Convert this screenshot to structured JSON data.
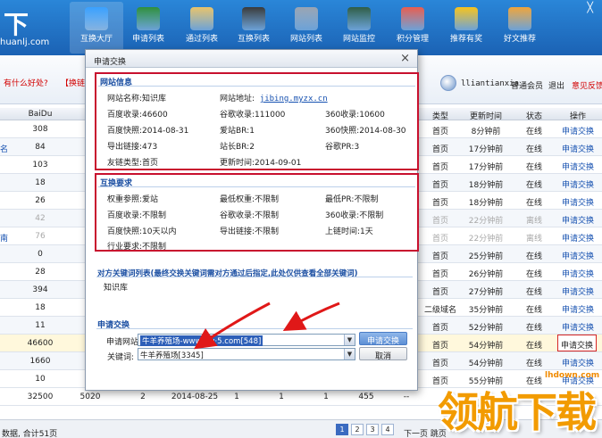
{
  "header": {
    "logo_big": "下",
    "logo_small": "huanlj.com",
    "nav": [
      {
        "label": "互换大厅",
        "icon": "monitor-icon",
        "color": "#3aa0ff"
      },
      {
        "label": "申请列表",
        "icon": "pie-chart-icon",
        "color": "#2f8f3c"
      },
      {
        "label": "通过列表",
        "icon": "clipboard-icon",
        "color": "#e8c36a"
      },
      {
        "label": "互换列表",
        "icon": "screen-icon",
        "color": "#3a3a3a"
      },
      {
        "label": "网站列表",
        "icon": "phone-icon",
        "color": "#9aa4b2"
      },
      {
        "label": "网站监控",
        "icon": "globe-icon",
        "color": "#2f5d45"
      },
      {
        "label": "积分管理",
        "icon": "calendar-icon",
        "color": "#e85d4f"
      },
      {
        "label": "推荐有奖",
        "icon": "star-icon",
        "color": "#f7c21c"
      },
      {
        "label": "好文推荐",
        "icon": "at-icon",
        "color": "#f0a43a"
      }
    ]
  },
  "infobar": {
    "tip_question": "有什么好处?",
    "tip_bracket": "【换链",
    "username": "lliantianxia",
    "level": "普通会员",
    "logout": "退出",
    "feedback": "意见反馈"
  },
  "table": {
    "headers": [
      "BaiDu",
      "类型",
      "更新时间",
      "状态",
      "操作"
    ],
    "rows": [
      {
        "baidu": "308",
        "type": "首页",
        "time": "8分钟前",
        "status": "在线",
        "action": "申请交换",
        "left": "",
        "grey": false
      },
      {
        "baidu": "84",
        "type": "首页",
        "time": "17分钟前",
        "status": "在线",
        "action": "申请交换",
        "left": "名",
        "grey": false
      },
      {
        "baidu": "103",
        "type": "首页",
        "time": "17分钟前",
        "status": "在线",
        "action": "申请交换",
        "left": "",
        "grey": false
      },
      {
        "baidu": "18",
        "type": "首页",
        "time": "18分钟前",
        "status": "在线",
        "action": "申请交换",
        "left": "",
        "grey": false
      },
      {
        "baidu": "26",
        "type": "首页",
        "time": "18分钟前",
        "status": "在线",
        "action": "申请交换",
        "left": "",
        "grey": false
      },
      {
        "baidu": "42",
        "type": "首页",
        "time": "22分钟前",
        "status": "离线",
        "action": "申请交换",
        "left": "",
        "grey": true
      },
      {
        "baidu": "76",
        "type": "首页",
        "time": "22分钟前",
        "status": "离线",
        "action": "申请交换",
        "left": "南",
        "grey": true
      },
      {
        "baidu": "0",
        "type": "首页",
        "time": "25分钟前",
        "status": "在线",
        "action": "申请交换",
        "left": "",
        "grey": false
      },
      {
        "baidu": "28",
        "type": "首页",
        "time": "26分钟前",
        "status": "在线",
        "action": "申请交换",
        "left": "",
        "grey": false
      },
      {
        "baidu": "394",
        "type": "首页",
        "time": "27分钟前",
        "status": "在线",
        "action": "申请交换",
        "left": "",
        "grey": false
      },
      {
        "baidu": "18",
        "type": "二级域名",
        "time": "35分钟前",
        "status": "在线",
        "action": "申请交换",
        "left": "",
        "grey": false
      },
      {
        "baidu": "11",
        "type": "首页",
        "time": "52分钟前",
        "status": "在线",
        "action": "申请交换",
        "left": "",
        "grey": false
      },
      {
        "baidu": "46600",
        "type": "首页",
        "time": "54分钟前",
        "status": "在线",
        "action": "申请交换",
        "left": "",
        "grey": false
      },
      {
        "baidu": "1660",
        "type": "首页",
        "time": "54分钟前",
        "status": "在线",
        "action": "申请交换",
        "left": "",
        "grey": false
      },
      {
        "baidu": "10",
        "type": "首页",
        "time": "55分钟前",
        "status": "在线",
        "action": "申请交换",
        "left": "",
        "grey": false
      }
    ],
    "last_row": [
      "32500",
      "5020",
      "2",
      "2014-08-25",
      "1",
      "1",
      "1",
      "455",
      "--"
    ],
    "footer_text": "数据, 合计51页",
    "pages": [
      "1",
      "2",
      "3",
      "4"
    ],
    "pager_tail": "下一页 跳页"
  },
  "watermark": {
    "url": "lhdown.com",
    "text": "领航下载"
  },
  "dialog": {
    "title": "申请交换",
    "site_info": {
      "title": "网站信息",
      "site_name_label": "网站名称:",
      "site_name": "知识库",
      "site_url_label": "网站地址:",
      "site_url": "jibing.myzx.cn",
      "baidu_label": "百度收录:",
      "baidu": "46600",
      "google_label": "谷歌收录:",
      "google": "111000",
      "s360_label": "360收录:",
      "s360": "10600",
      "baidu_snap_label": "百度快照:",
      "baidu_snap": "2014-08-31",
      "aizhan_br_label": "爱站BR:",
      "aizhan_br": "1",
      "snap360_label": "360快照:",
      "snap360": "2014-08-30",
      "outlinks_label": "导出链接:",
      "outlinks": "473",
      "zhanzhang_br_label": "站长BR:",
      "zhanzhang_br": "2",
      "google_pr_label": "谷歌PR:",
      "google_pr": "3",
      "link_type_label": "友链类型:",
      "link_type": "首页",
      "updated_label": "更新时间:",
      "updated": "2014-09-01"
    },
    "requirements": {
      "title": "互换要求",
      "weight_label": "权重参照:",
      "weight": "爱站",
      "min_weight_label": "最低权重:",
      "min_weight": "不限制",
      "min_pr_label": "最低PR:",
      "min_pr": "不限制",
      "baidu_label": "百度收录:",
      "baidu": "不限制",
      "google_label": "谷歌收录:",
      "google": "不限制",
      "s360_label": "360收录:",
      "s360": "不限制",
      "snap_label": "百度快照:",
      "snap": "10天以内",
      "outlinks_label": "导出链接:",
      "outlinks": "不限制",
      "online_label": "上链时间:",
      "online": "1天",
      "industry_label": "行业要求:",
      "industry": "不限制"
    },
    "keywords": {
      "title": "对方关键词列表(最终交换关键词需对方通过后指定,此处仅供查看全部关键词)",
      "value": "知识库"
    },
    "apply": {
      "title": "申请交换",
      "site_label": "申请网站:",
      "site_value": "牛羊养殖场-www.niu·5.com[548]",
      "keyword_label": "关键词:",
      "keyword_value": "牛羊养殖场[3345]",
      "apply_btn": "申请交换",
      "cancel_btn": "取消"
    }
  }
}
